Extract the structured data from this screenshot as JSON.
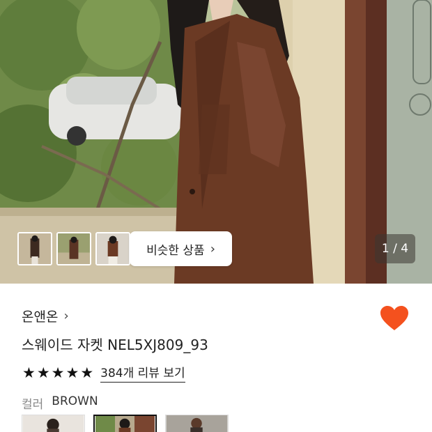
{
  "gallery": {
    "counter": "1 / 4",
    "similar_button_label": "비슷한 상품",
    "similar_button_chevron": "›",
    "thumbnail_count": 3
  },
  "product": {
    "brand": "온앤온",
    "brand_chevron": "›",
    "name": "스웨이드 자켓 NEL5XJ809_93",
    "rating_stars": 5,
    "stars": [
      "★",
      "★",
      "★",
      "★",
      "★"
    ],
    "review_link": "384개 리뷰 보기",
    "liked": true
  },
  "options": {
    "color_label": "컬러",
    "color_value": "BROWN"
  },
  "colors": {
    "heart": "#f4511e",
    "jacket": "#6b3a24"
  }
}
